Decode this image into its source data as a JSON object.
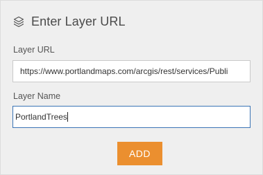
{
  "header": {
    "icon": "layers-icon",
    "title": "Enter Layer URL"
  },
  "form": {
    "layer_url": {
      "label": "Layer URL",
      "value": "https://www.portlandmaps.com/arcgis/rest/services/Publi"
    },
    "layer_name": {
      "label": "Layer Name",
      "value": "PortlandTrees"
    },
    "add_label": "ADD"
  },
  "colors": {
    "panel_bg": "#efefef",
    "accent_button": "#eb8f2f",
    "focus_border": "#3a73b5"
  }
}
